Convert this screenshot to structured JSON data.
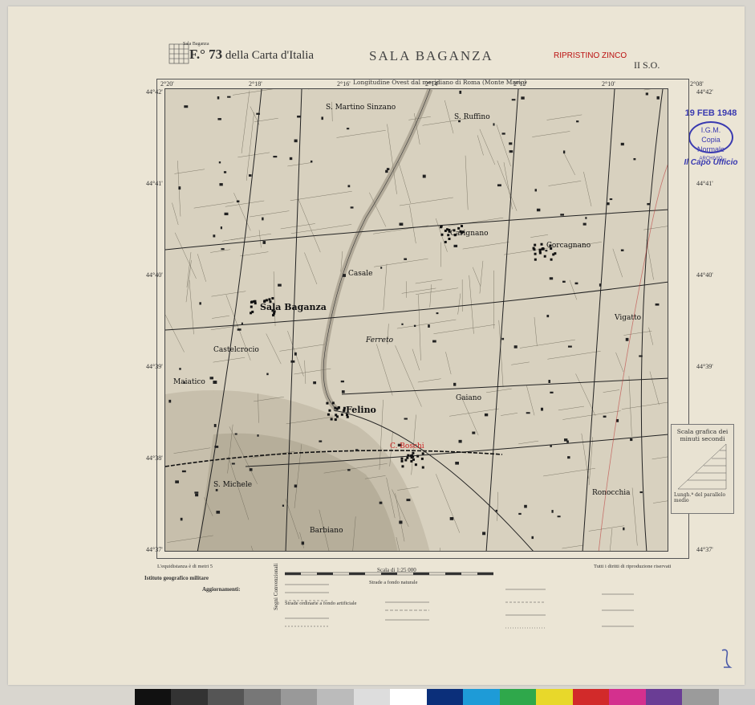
{
  "header": {
    "sheet_number": "F.° 73",
    "sheet_series": "della Carta d'Italia",
    "title": "SALA BAGANZA",
    "quadrant": "II S.O.",
    "stamp_red": "RIPRISTINO ZINCO",
    "meridian_note": "Longitudine Ovest dal meridiano di Roma (Monte Mario)",
    "mini_index_label": "Sala Baganza"
  },
  "stamp": {
    "date": "19 FEB 1948",
    "seal_line1": "I.G.M.",
    "seal_line2": "Copia Normale",
    "seal_line3": "ARCHIVIO",
    "office": "Il Capo Ufficio"
  },
  "coords": {
    "top": [
      "2°20'",
      "2°18'",
      "2°16'",
      "2°14'",
      "2°12'",
      "2°10'",
      "2°08'"
    ],
    "left": [
      "44°42'",
      "44°41'",
      "44°40'",
      "44°39'",
      "44°38'",
      "44°37'"
    ],
    "right": [
      "44°42'",
      "44°41'",
      "44°40'",
      "44°39'",
      "44°38'",
      "44°37'"
    ]
  },
  "places": [
    {
      "name": "Sala Baganza",
      "cls": "big"
    },
    {
      "name": "Felino",
      "cls": "big"
    },
    {
      "name": "Casale",
      "cls": ""
    },
    {
      "name": "Ferreto",
      "cls": "it"
    },
    {
      "name": "Carignano",
      "cls": ""
    },
    {
      "name": "Corcagnano",
      "cls": ""
    },
    {
      "name": "Vigatto",
      "cls": ""
    },
    {
      "name": "S. Michele",
      "cls": ""
    },
    {
      "name": "Barbiano",
      "cls": ""
    },
    {
      "name": "Ronocchia",
      "cls": ""
    },
    {
      "name": "Maiatico",
      "cls": ""
    },
    {
      "name": "S. Ruffino",
      "cls": ""
    },
    {
      "name": "C. Boschi",
      "cls": "red2"
    },
    {
      "name": "Gaiano",
      "cls": ""
    },
    {
      "name": "S. Martino Sinzano",
      "cls": ""
    },
    {
      "name": "Castelcrocio",
      "cls": ""
    }
  ],
  "scale_box": {
    "title": "Scala grafica dei minuti secondi",
    "note": "Lungh.ª del parallelo medio"
  },
  "legend": {
    "equidistance": "L'equidistanza è di metri 5",
    "institute": "Istituto geografico militare",
    "updates": "Aggiornamenti:",
    "scale": "Scala di 1:25 000",
    "signs": "Segni Convenzionali",
    "roads": "Strade ordinarie a fondo artificiale",
    "rails": "Strade a fondo naturale",
    "credit": "Tutti i diritti di riproduzione riservati"
  },
  "colors": {
    "paper": "#ebe5d5",
    "map": "#d8d1bf",
    "ink": "#222222",
    "stamp_blue": "#3a3ab0",
    "stamp_red": "#bb1111"
  },
  "colorbar": [
    "#111111",
    "#333333",
    "#555555",
    "#777777",
    "#999999",
    "#bbbbbb",
    "#dddddd",
    "#ffffff",
    "#0b2f7a",
    "#1e9bd7",
    "#2fa84b",
    "#e8d82a",
    "#d22a2a",
    "#d4308e",
    "#6a3d95",
    "#9b9b9b",
    "#c9c9c9"
  ]
}
